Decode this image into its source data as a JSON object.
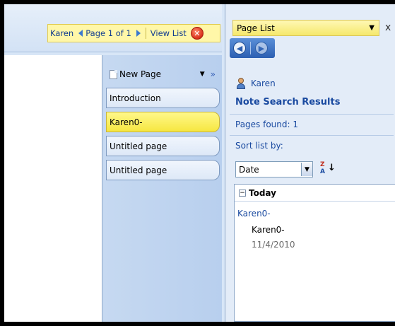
{
  "searchbar": {
    "scope": "Karen",
    "page_info": "Page 1 of 1",
    "view_list": "View List"
  },
  "pages": {
    "new_page_label": "New Page",
    "tabs": [
      {
        "label": "Introduction",
        "active": false
      },
      {
        "label": "Karen0-",
        "active": true
      },
      {
        "label": "Untitled page",
        "active": false
      },
      {
        "label": "Untitled page",
        "active": false
      }
    ]
  },
  "pane": {
    "title": "Page List",
    "close_glyph": "x",
    "search_term": "Karen",
    "heading": "Note Search Results",
    "pages_found": "Pages found: 1",
    "sort_label": "Sort list by:",
    "sort_value": "Date",
    "results": {
      "group": "Today",
      "item_title": "Karen0-",
      "item_page": "Karen0-",
      "item_date": "11/4/2010"
    }
  },
  "colors": {
    "highlight": "#fff7a8",
    "accent": "#1a4aa0",
    "pane_bg": "#e3ecf8"
  }
}
